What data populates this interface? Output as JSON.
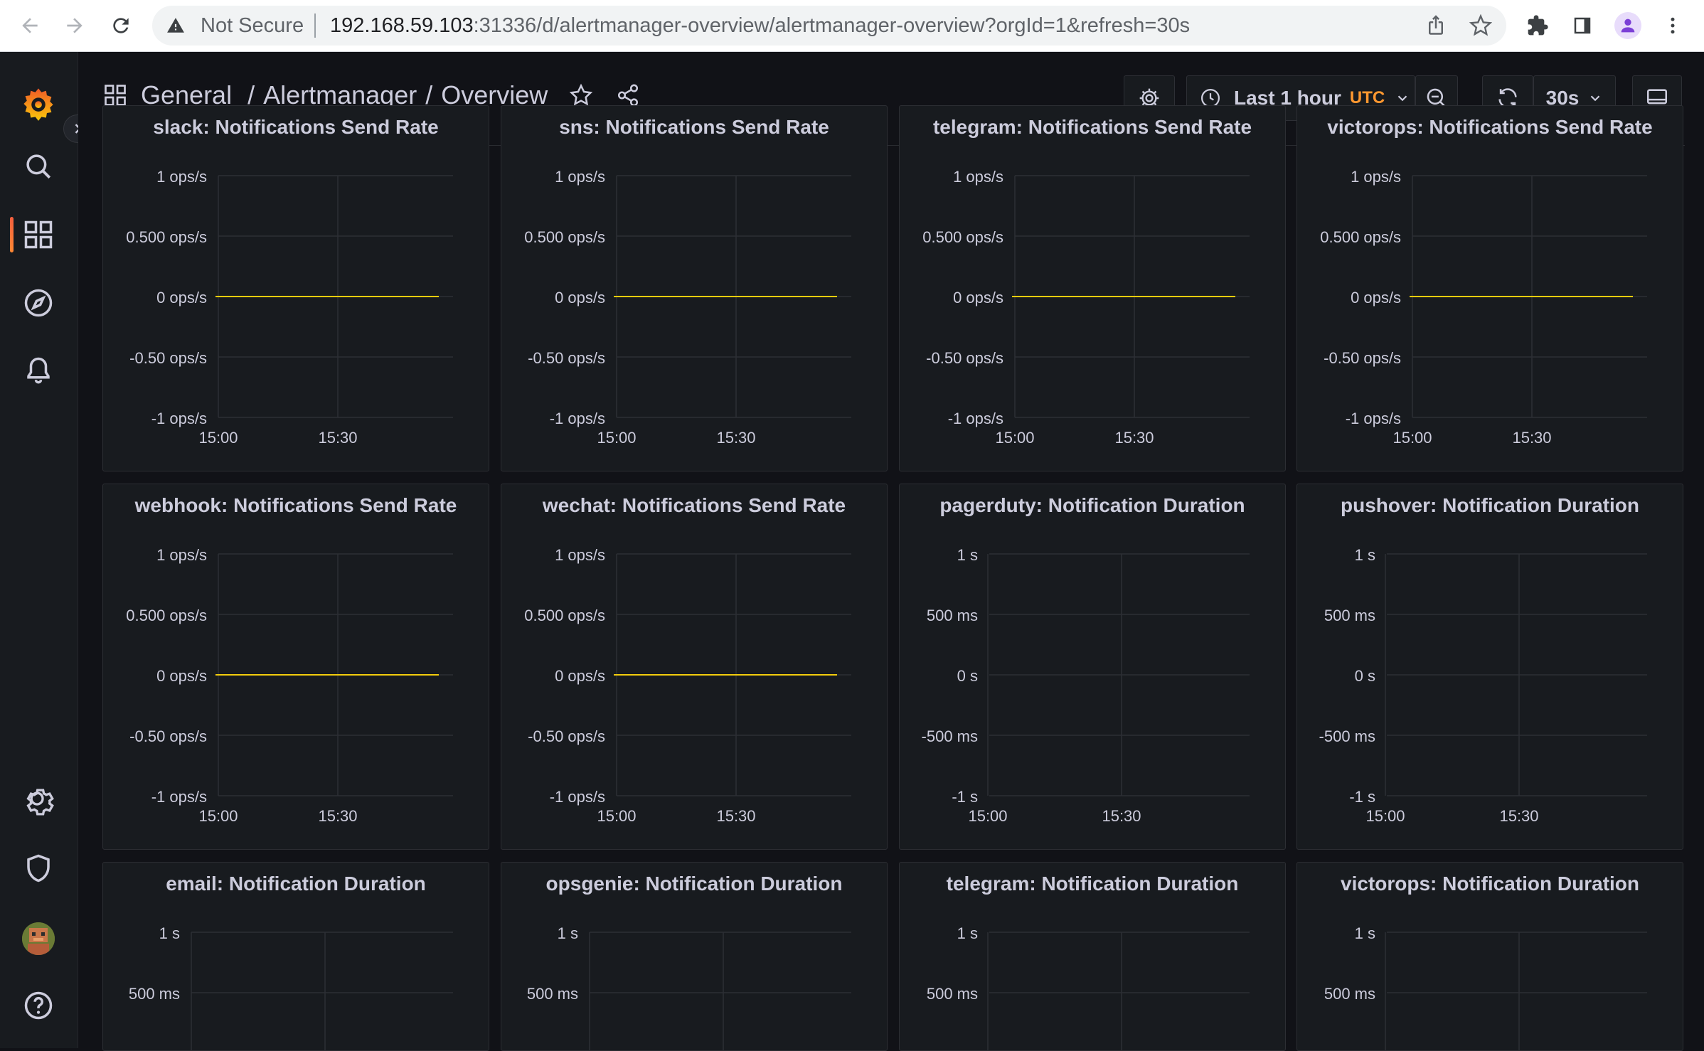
{
  "browser": {
    "security_label": "Not Secure",
    "url_host": "192.168.59.103",
    "url_rest": ":31336/d/alertmanager-overview/alertmanager-overview?orgId=1&refresh=30s"
  },
  "breadcrumb": {
    "folder": "General",
    "sep1": "/",
    "dashboard": "Alertmanager",
    "sep2": "/",
    "page": "Overview"
  },
  "toolbar": {
    "time_range": "Last 1 hour",
    "timezone": "UTC",
    "refresh_interval": "30s"
  },
  "colors": {
    "series_line": "#f2cc0c",
    "grid": "#2c2f35",
    "axis_text": "#ccccdc",
    "accent": "#ff8833"
  },
  "panels": [
    {
      "title": "slack: Notifications Send Rate",
      "y_ticks": [
        "1 ops/s",
        "0.500 ops/s",
        "0 ops/s",
        "-0.50 ops/s",
        "-1 ops/s"
      ],
      "x_ticks": [
        "15:00",
        "15:30"
      ],
      "has_series": true
    },
    {
      "title": "sns: Notifications Send Rate",
      "y_ticks": [
        "1 ops/s",
        "0.500 ops/s",
        "0 ops/s",
        "-0.50 ops/s",
        "-1 ops/s"
      ],
      "x_ticks": [
        "15:00",
        "15:30"
      ],
      "has_series": true
    },
    {
      "title": "telegram: Notifications Send Rate",
      "y_ticks": [
        "1 ops/s",
        "0.500 ops/s",
        "0 ops/s",
        "-0.50 ops/s",
        "-1 ops/s"
      ],
      "x_ticks": [
        "15:00",
        "15:30"
      ],
      "has_series": true
    },
    {
      "title": "victorops: Notifications Send Rate",
      "y_ticks": [
        "1 ops/s",
        "0.500 ops/s",
        "0 ops/s",
        "-0.50 ops/s",
        "-1 ops/s"
      ],
      "x_ticks": [
        "15:00",
        "15:30"
      ],
      "has_series": true
    },
    {
      "title": "webhook: Notifications Send Rate",
      "y_ticks": [
        "1 ops/s",
        "0.500 ops/s",
        "0 ops/s",
        "-0.50 ops/s",
        "-1 ops/s"
      ],
      "x_ticks": [
        "15:00",
        "15:30"
      ],
      "has_series": true
    },
    {
      "title": "wechat: Notifications Send Rate",
      "y_ticks": [
        "1 ops/s",
        "0.500 ops/s",
        "0 ops/s",
        "-0.50 ops/s",
        "-1 ops/s"
      ],
      "x_ticks": [
        "15:00",
        "15:30"
      ],
      "has_series": true
    },
    {
      "title": "pagerduty: Notification Duration",
      "y_ticks": [
        "1 s",
        "500 ms",
        "0 s",
        "-500 ms",
        "-1 s"
      ],
      "x_ticks": [
        "15:00",
        "15:30"
      ],
      "has_series": false
    },
    {
      "title": "pushover: Notification Duration",
      "y_ticks": [
        "1 s",
        "500 ms",
        "0 s",
        "-500 ms",
        "-1 s"
      ],
      "x_ticks": [
        "15:00",
        "15:30"
      ],
      "has_series": false
    },
    {
      "title": "email: Notification Duration",
      "y_ticks": [
        "1 s",
        "500 ms"
      ],
      "x_ticks": [],
      "has_series": false
    },
    {
      "title": "opsgenie: Notification Duration",
      "y_ticks": [
        "1 s",
        "500 ms"
      ],
      "x_ticks": [],
      "has_series": false
    },
    {
      "title": "telegram: Notification Duration",
      "y_ticks": [
        "1 s",
        "500 ms"
      ],
      "x_ticks": [],
      "has_series": false
    },
    {
      "title": "victorops: Notification Duration",
      "y_ticks": [
        "1 s",
        "500 ms"
      ],
      "x_ticks": [],
      "has_series": false
    }
  ]
}
